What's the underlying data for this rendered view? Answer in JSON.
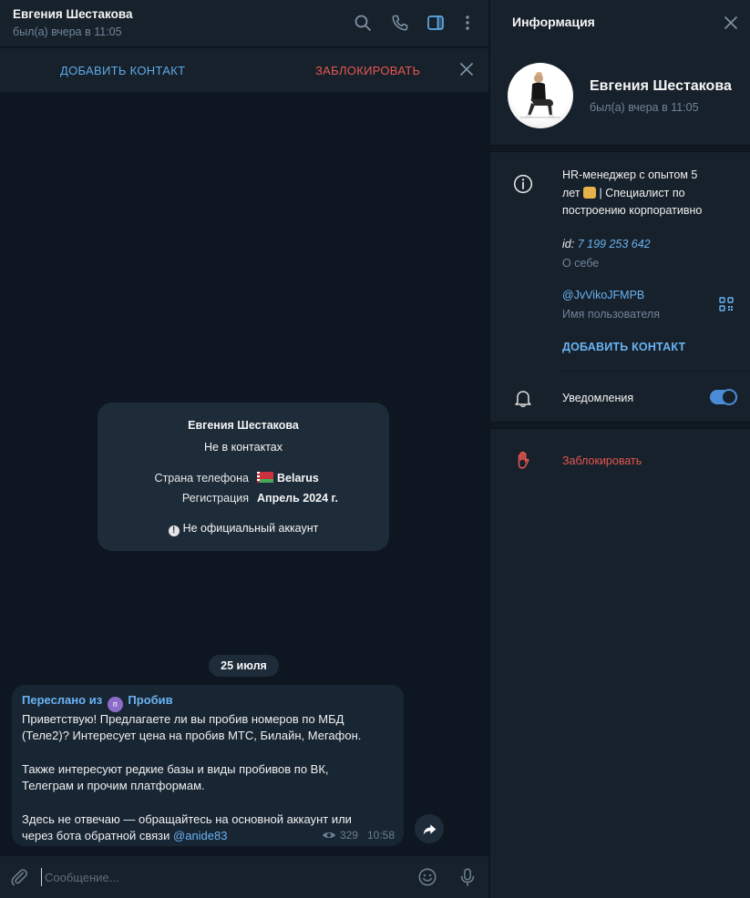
{
  "chat": {
    "name": "Евгения Шестакова",
    "status": "был(а) вчера в 11:05"
  },
  "action_bar": {
    "add_contact": "ДОБАВИТЬ КОНТАКТ",
    "block": "ЗАБЛОКИРОВАТЬ"
  },
  "info_card": {
    "name": "Евгения Шестакова",
    "subtitle": "Не в контактах",
    "phone_country_label": "Страна телефона",
    "phone_country_value": "Belarus",
    "registration_label": "Регистрация",
    "registration_value": "Апрель 2024 г.",
    "warning": "Не официальный аккаунт"
  },
  "date_separator": "25 июля",
  "message": {
    "forwarded_prefix": "Переслано из",
    "forwarded_source": "Пробив",
    "forwarded_avatar_letter": "п",
    "lines": [
      "Приветствую! Предлагаете ли вы пробив номеров по МБД",
      "(Теле2)? Интересует цена на пробив МТС, Билайн, Мегафон.",
      "Также интересуют редкие базы и виды пробивов по ВК,",
      "Телеграм и прочим платформам.",
      "Здесь не отвечаю — обращайтесь на основной аккаунт или",
      "через бота обратной связи "
    ],
    "mention": "@anide83",
    "views": "329",
    "time": "10:58"
  },
  "composer": {
    "placeholder": "Сообщение..."
  },
  "side": {
    "title": "Информация",
    "name": "Евгения Шестакова",
    "status": "был(а) вчера в 11:05",
    "bio_lines": [
      "HR-менеджер с опытом 5",
      "лет",
      "| Специалист по",
      "построению корпоративно"
    ],
    "id_prefix": "id:",
    "id_value": "7 199 253 642",
    "about_label": "О себе",
    "username": "@JvVikoJFMPB",
    "username_label": "Имя пользователя",
    "add_contact": "ДОБАВИТЬ КОНТАКТ",
    "notifications": "Уведомления",
    "notifications_on": true,
    "block": "Заблокировать"
  },
  "colors": {
    "accent": "#6ab3f3",
    "danger": "#e5574f",
    "panel": "#17212b",
    "chat_bg": "#0e1621",
    "bubble": "#182533"
  },
  "icons": {
    "header": [
      "search-icon",
      "phone-icon",
      "sidebar-toggle-icon",
      "more-icon"
    ],
    "composer": [
      "attach-icon",
      "emoji-icon",
      "microphone-icon"
    ],
    "side": [
      "info-icon",
      "qr-code-icon",
      "bell-icon",
      "block-hand-icon",
      "close-icon"
    ]
  }
}
